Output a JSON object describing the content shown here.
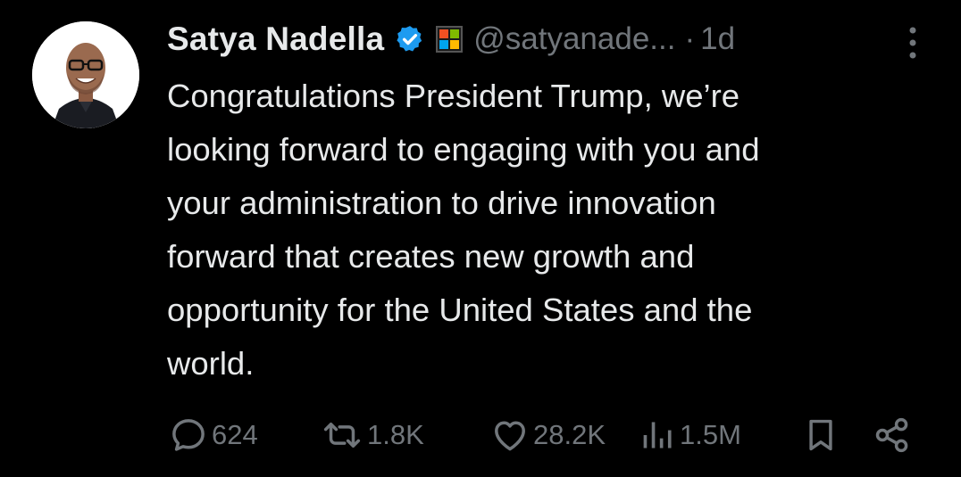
{
  "tweet": {
    "author": {
      "display_name": "Satya Nadella",
      "handle": "@satyanade...",
      "verified": true
    },
    "separator": "·",
    "timestamp": "1d",
    "text": "Congratulations President Trump, we’re\nlooking forward to engaging with you and\nyour administration to drive innovation\nforward that creates new growth and\nopportunity for the United States and the\nworld.",
    "actions": {
      "replies": "624",
      "reposts": "1.8K",
      "likes": "28.2K",
      "views": "1.5M"
    }
  },
  "colors": {
    "background": "#000000",
    "primary_text": "#e7e9ea",
    "secondary_text": "#71767b",
    "verified_badge": "#1d9bf0"
  },
  "icons": {
    "verified": "verified-badge-icon",
    "affiliate": "microsoft-logo-icon",
    "more": "more-vertical-icon",
    "reply": "speech-bubble-icon",
    "repost": "repost-arrows-icon",
    "like": "heart-icon",
    "views": "bar-chart-icon",
    "bookmark": "bookmark-icon",
    "share": "share-icon"
  }
}
